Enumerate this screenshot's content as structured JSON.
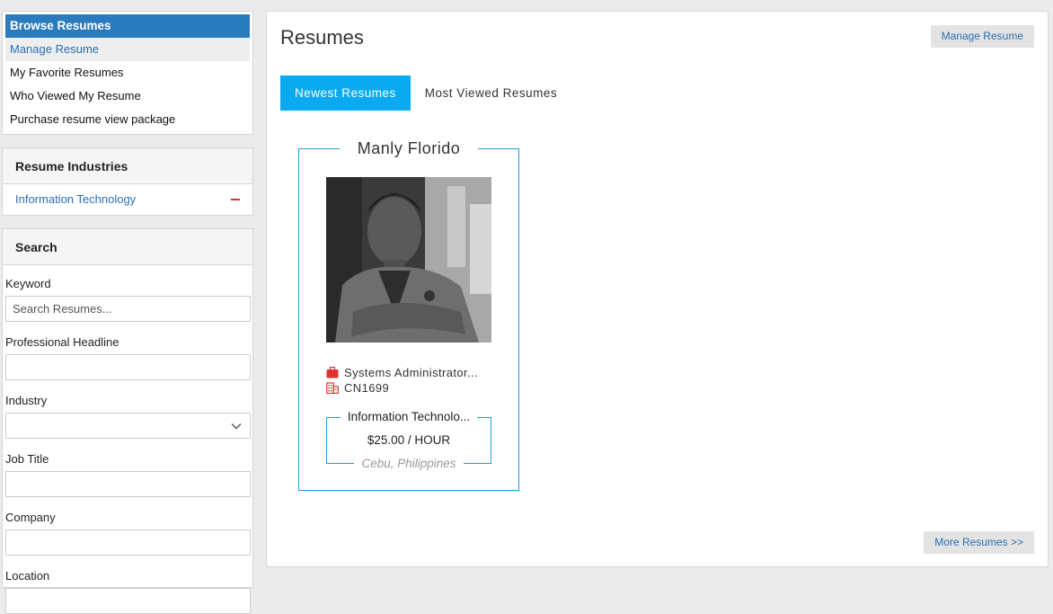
{
  "sidebar": {
    "menu": [
      {
        "label": "Browse Resumes",
        "state": "active"
      },
      {
        "label": "Manage Resume",
        "state": "hover"
      },
      {
        "label": "My Favorite Resumes",
        "state": "normal"
      },
      {
        "label": "Who Viewed My Resume",
        "state": "normal"
      },
      {
        "label": "Purchase resume view package",
        "state": "normal"
      }
    ],
    "industries": {
      "title": "Resume Industries",
      "items": [
        {
          "label": "Information Technology"
        }
      ]
    },
    "search": {
      "title": "Search",
      "keyword_label": "Keyword",
      "keyword_placeholder": "Search Resumes...",
      "headline_label": "Professional Headline",
      "industry_label": "Industry",
      "job_title_label": "Job Title",
      "company_label": "Company",
      "location_label": "Location"
    }
  },
  "main": {
    "title": "Resumes",
    "manage_button": "Manage Resume",
    "tabs": [
      {
        "label": "Newest Resumes",
        "active": true
      },
      {
        "label": "Most Viewed Resumes",
        "active": false
      }
    ],
    "more_button": "More Resumes >>",
    "cards": [
      {
        "name": "Manly Florido",
        "job_title": "Systems Administrator...",
        "company": "CN1699",
        "industry": "Information Technolo...",
        "rate": "$25.00 / HOUR",
        "location": "Cebu, Philippines"
      }
    ]
  },
  "colors": {
    "active_menu": "#2a7bbd",
    "tab_active": "#0aaaf0",
    "card_border": "#1f9fd9",
    "link": "#2a6fb3",
    "icon_red": "#e03131"
  },
  "icons": {
    "job": "briefcase-icon",
    "company": "building-icon",
    "remove": "minus-icon",
    "dropdown": "chevron-down-icon"
  }
}
